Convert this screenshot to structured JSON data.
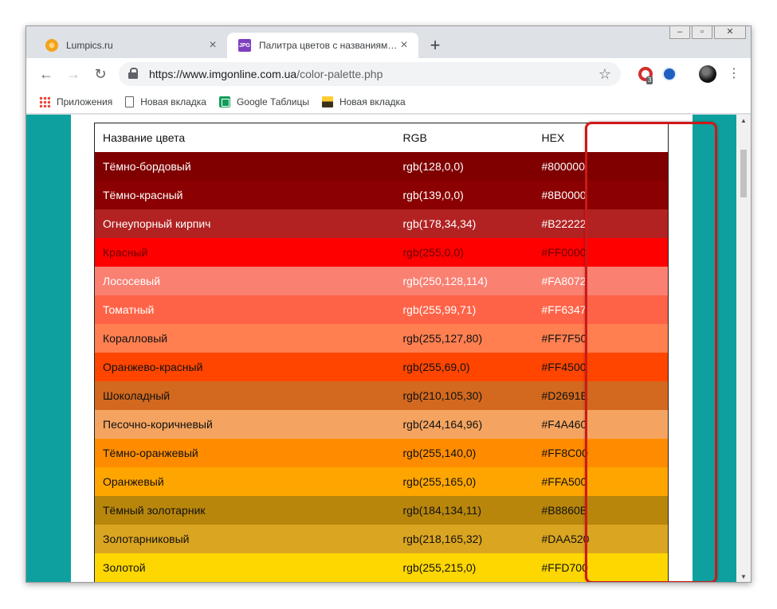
{
  "tabs": [
    {
      "title": "Lumpics.ru",
      "active": false
    },
    {
      "title": "Палитра цветов с названиями -",
      "active": true
    }
  ],
  "tab_icon_text": "JPG",
  "toolbar": {
    "url_host": "https://www.imgonline.com.ua",
    "url_path": "/color-palette.php",
    "opera_badge": "3"
  },
  "bookmarks": [
    {
      "label": "Приложения",
      "icon": "apps-grid-icon"
    },
    {
      "label": "Новая вкладка",
      "icon": "page-icon"
    },
    {
      "label": "Google Таблицы",
      "icon": "sheets-icon"
    },
    {
      "label": "Новая вкладка",
      "icon": "image-icon"
    }
  ],
  "table": {
    "headers": [
      "Название цвета",
      "RGB",
      "HEX"
    ],
    "rows": [
      {
        "name": "Тёмно-бордовый",
        "rgb": "rgb(128,0,0)",
        "hex": "#800000",
        "text": "#ffffff"
      },
      {
        "name": "Тёмно-красный",
        "rgb": "rgb(139,0,0)",
        "hex": "#8B0000",
        "text": "#ffffff"
      },
      {
        "name": "Огнеупорный кирпич",
        "rgb": "rgb(178,34,34)",
        "hex": "#B22222",
        "text": "#ffffff"
      },
      {
        "name": "Красный",
        "rgb": "rgb(255,0,0)",
        "hex": "#FF0000",
        "text": "#6a0000"
      },
      {
        "name": "Лососевый",
        "rgb": "rgb(250,128,114)",
        "hex": "#FA8072",
        "text": "#ffffff"
      },
      {
        "name": "Томатный",
        "rgb": "rgb(255,99,71)",
        "hex": "#FF6347",
        "text": "#ffffff"
      },
      {
        "name": "Коралловый",
        "rgb": "rgb(255,127,80)",
        "hex": "#FF7F50",
        "text": "#111111"
      },
      {
        "name": "Оранжево-красный",
        "rgb": "rgb(255,69,0)",
        "hex": "#FF4500",
        "text": "#111111"
      },
      {
        "name": "Шоколадный",
        "rgb": "rgb(210,105,30)",
        "hex": "#D2691E",
        "text": "#111111"
      },
      {
        "name": "Песочно-коричневый",
        "rgb": "rgb(244,164,96)",
        "hex": "#F4A460",
        "text": "#111111"
      },
      {
        "name": "Тёмно-оранжевый",
        "rgb": "rgb(255,140,0)",
        "hex": "#FF8C00",
        "text": "#111111"
      },
      {
        "name": "Оранжевый",
        "rgb": "rgb(255,165,0)",
        "hex": "#FFA500",
        "text": "#111111"
      },
      {
        "name": "Тёмный золотарник",
        "rgb": "rgb(184,134,11)",
        "hex": "#B8860B",
        "text": "#111111"
      },
      {
        "name": "Золотарниковый",
        "rgb": "rgb(218,165,32)",
        "hex": "#DAA520",
        "text": "#111111"
      },
      {
        "name": "Золотой",
        "rgb": "rgb(255,215,0)",
        "hex": "#FFD700",
        "text": "#111111"
      }
    ]
  },
  "colors": {
    "page_background": "#0ea09e",
    "highlight_border": "#d01818"
  }
}
